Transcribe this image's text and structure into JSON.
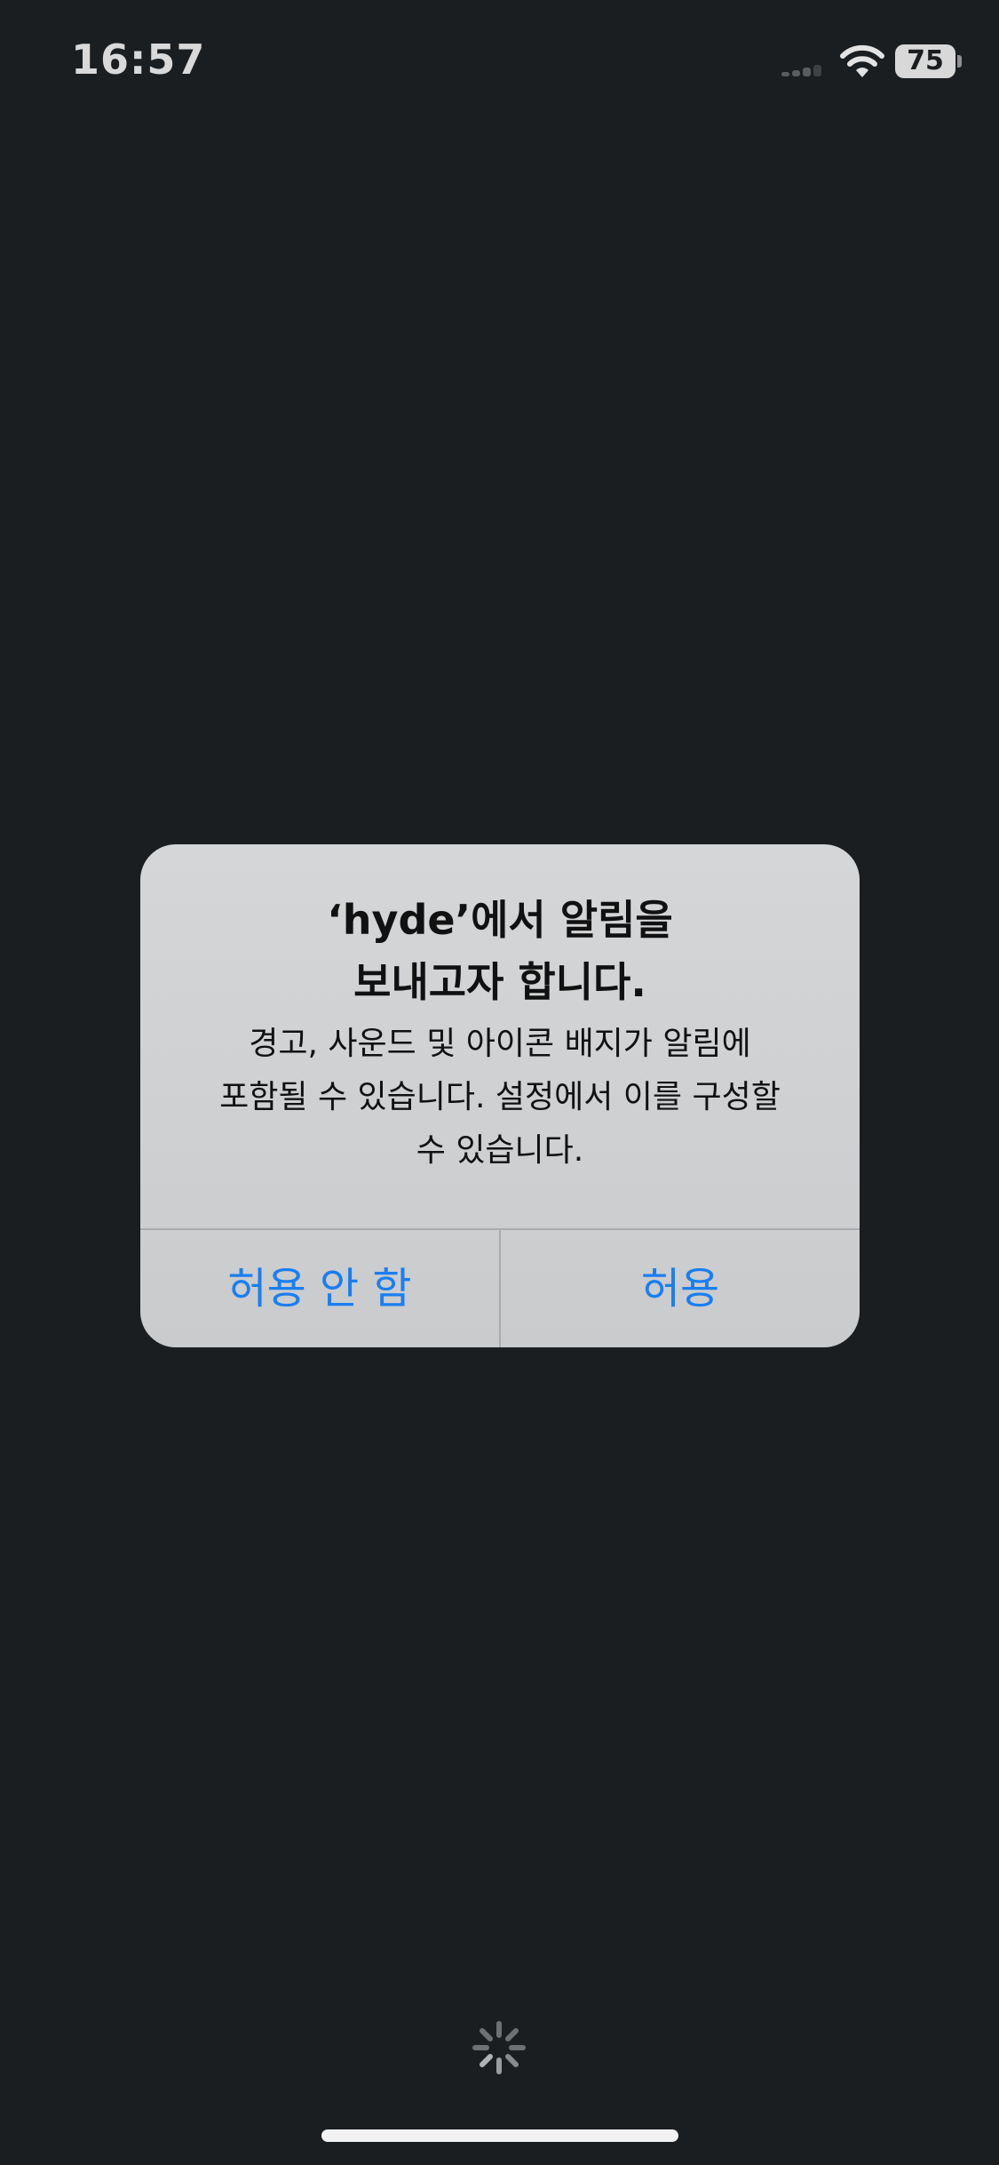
{
  "status_bar": {
    "time": "16:57",
    "battery": "75",
    "icons": [
      "signal-icon",
      "wifi-icon",
      "battery-icon"
    ]
  },
  "alert": {
    "title": "‘hyde’에서 알림을\n보내고자 합니다.",
    "message": "경고, 사운드 및 아이콘 배지가 알림에\n포함될 수 있습니다. 설정에서 이를 구성할\n수 있습니다.",
    "deny_label": "허용 안 함",
    "allow_label": "허용"
  },
  "colors": {
    "background": "#1b1e21",
    "alert_bg": "#d4d6d8",
    "button_text": "#1a7ef0"
  },
  "loading_icon": "activity-spinner-icon"
}
